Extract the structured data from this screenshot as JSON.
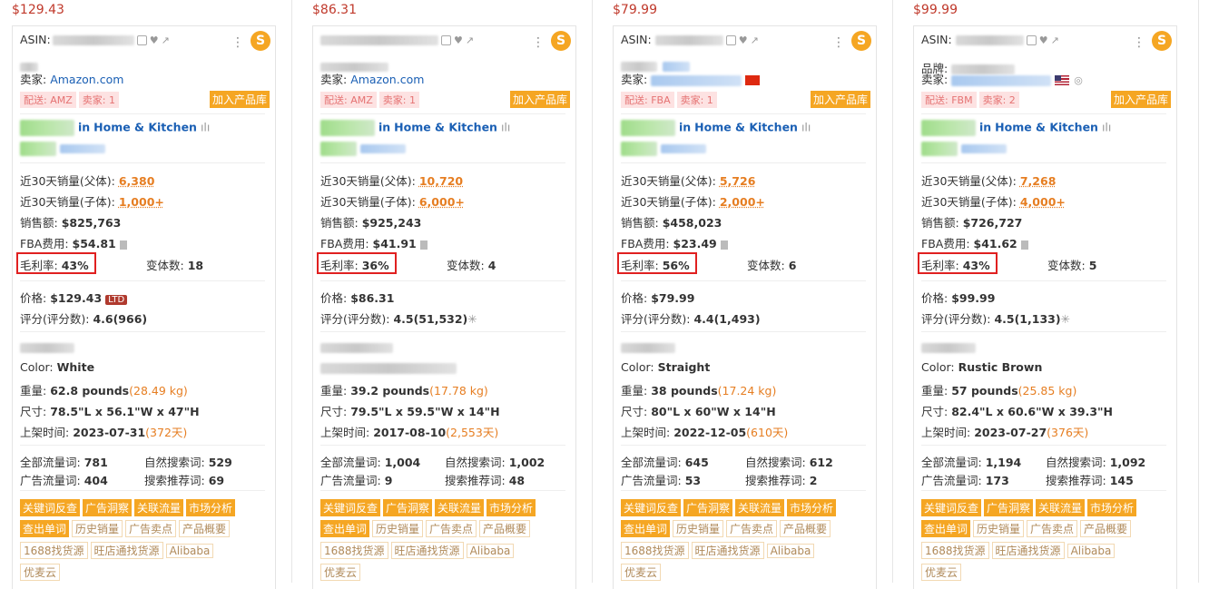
{
  "labels": {
    "asin": "ASIN:",
    "brand": "品牌:",
    "seller": "卖家:",
    "category_in": "in",
    "sales30_parent": "近30天销量(父体):",
    "sales30_child": "近30天销量(子体):",
    "revenue": "销售额:",
    "fba_fee": "FBA费用:",
    "margin": "毛利率:",
    "variants": "变体数:",
    "price": "价格:",
    "rating": "评分(评分数):",
    "color": "Color:",
    "weight": "重量:",
    "size": "尺寸:",
    "listed": "上架时间:",
    "all_kw": "全部流量词:",
    "natural_kw": "自然搜索词:",
    "ad_kw": "广告流量词:",
    "suggest_kw": "搜索推荐词:",
    "add_to_lib": "加入产品库"
  },
  "actions": {
    "row1": [
      "关键词反查",
      "广告洞察",
      "关联流量",
      "市场分析"
    ],
    "row2_primary": "查出单词",
    "row2": [
      "历史销量",
      "广告卖点",
      "产品概要"
    ],
    "row3": [
      "1688找货源",
      "旺店通找货源",
      "Alibaba"
    ],
    "row4": [
      "优麦云"
    ]
  },
  "products": [
    {
      "top_price": "$129.43",
      "asin": "",
      "seller": "Amazon.com",
      "ship": "配送: AMZ",
      "seller_count": "卖家: 1",
      "category": "Home & Kitchen",
      "sales_parent": "6,380",
      "sales_child": "1,000+",
      "revenue": "$825,763",
      "fba": "$54.81",
      "margin": "43%",
      "variants": "18",
      "price": "$129.43",
      "ltd": "LTD",
      "rating": "4.6(966)",
      "color": "White",
      "weight": "62.8 pounds",
      "weight_kg": "(28.49 kg)",
      "size": "78.5\"L x 56.1\"W x 47\"H",
      "listed": "2023-07-31",
      "days": "(372天)",
      "all_kw": "781",
      "natural_kw": "529",
      "ad_kw": "404",
      "suggest_kw": "69"
    },
    {
      "top_price": "$86.31",
      "asin": "",
      "seller": "Amazon.com",
      "ship": "配送: AMZ",
      "seller_count": "卖家: 1",
      "category": "Home & Kitchen",
      "sales_parent": "10,720",
      "sales_child": "6,000+",
      "revenue": "$925,243",
      "fba": "$41.91",
      "margin": "36%",
      "variants": "4",
      "price": "$86.31",
      "ltd": "",
      "rating": "4.5(51,532)",
      "color": "",
      "weight": "39.2 pounds",
      "weight_kg": "(17.78 kg)",
      "size": "79.5\"L x 59.5\"W x 14\"H",
      "listed": "2017-08-10",
      "days": "(2,553天)",
      "all_kw": "1,004",
      "natural_kw": "1,002",
      "ad_kw": "9",
      "suggest_kw": "48"
    },
    {
      "top_price": "$79.99",
      "asin": "ASIN:",
      "seller": "",
      "ship": "配送: FBA",
      "seller_count": "卖家: 1",
      "category": "Home & Kitchen",
      "sales_parent": "5,726",
      "sales_child": "2,000+",
      "revenue": "$458,023",
      "fba": "$23.49",
      "margin": "56%",
      "variants": "6",
      "price": "$79.99",
      "ltd": "",
      "rating": "4.4(1,493)",
      "color": "Straight",
      "weight": "38 pounds",
      "weight_kg": "(17.24 kg)",
      "size": "80\"L x 60\"W x 14\"H",
      "listed": "2022-12-05",
      "days": "(610天)",
      "all_kw": "645",
      "natural_kw": "612",
      "ad_kw": "53",
      "suggest_kw": "2"
    },
    {
      "top_price": "$99.99",
      "asin": "ASIN:",
      "seller": "",
      "ship": "配送: FBM",
      "seller_count": "卖家: 2",
      "category": "Home & Kitchen",
      "sales_parent": "7,268",
      "sales_child": "4,000+",
      "revenue": "$726,727",
      "fba": "$41.62",
      "margin": "43%",
      "variants": "5",
      "price": "$99.99",
      "ltd": "",
      "rating": "4.5(1,133)",
      "color": "Rustic Brown",
      "weight": "57 pounds",
      "weight_kg": "(25.85 kg)",
      "size": "82.4\"L x 60.6\"W x 39.3\"H",
      "listed": "2023-07-27",
      "days": "(376天)",
      "all_kw": "1,194",
      "natural_kw": "1,092",
      "ad_kw": "173",
      "suggest_kw": "145"
    }
  ]
}
